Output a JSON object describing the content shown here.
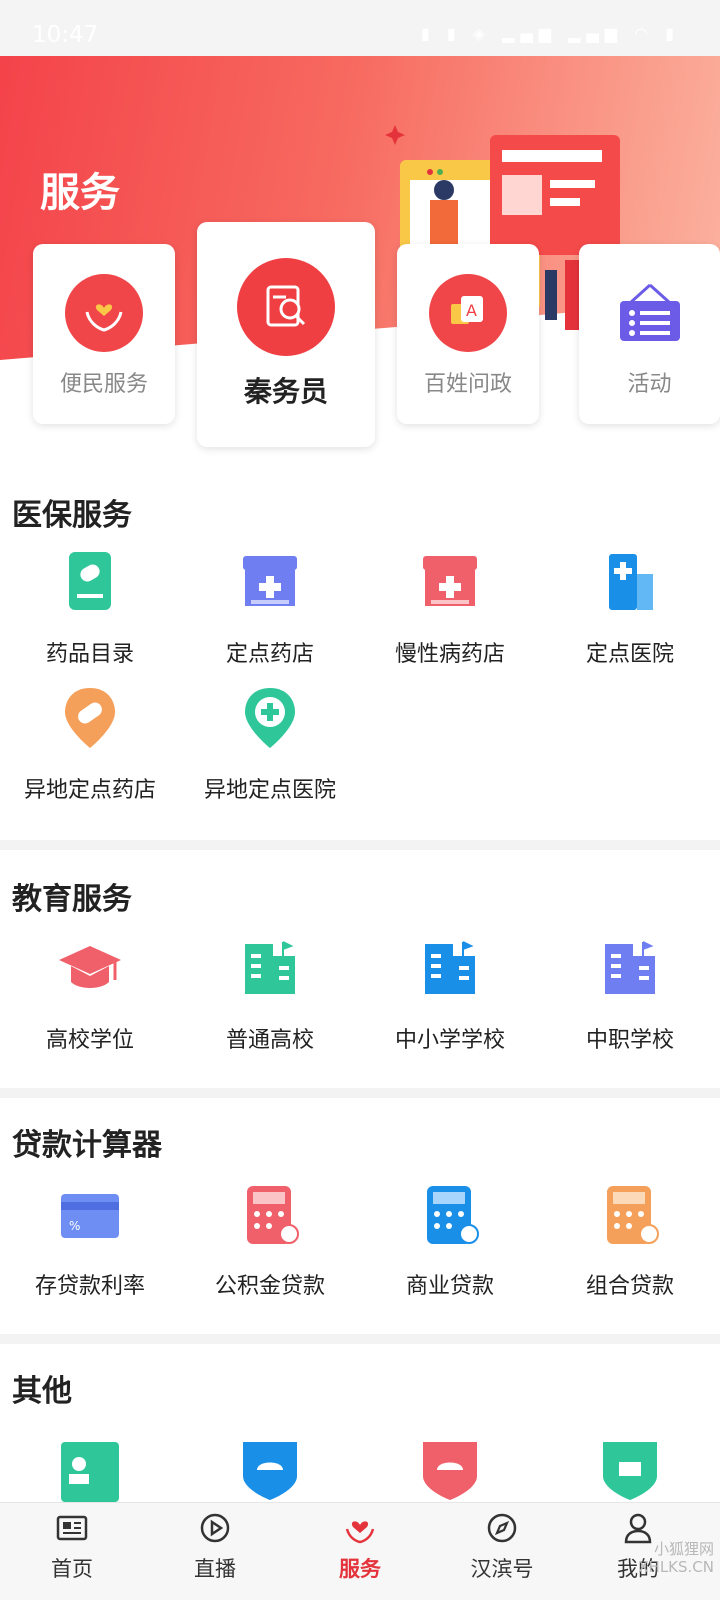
{
  "status": {
    "time": "10:47"
  },
  "header": {
    "title": "服务"
  },
  "top_cards": [
    {
      "label": "便民服务",
      "icon": "hands-heart-icon"
    },
    {
      "label": "秦务员",
      "icon": "search-doc-icon"
    },
    {
      "label": "百姓问政",
      "icon": "question-bubble-icon"
    },
    {
      "label": "活动",
      "icon": "event-board-icon"
    }
  ],
  "sections": {
    "medical": {
      "title": "医保服务",
      "items": [
        {
          "label": "药品目录",
          "icon": "medicine-catalog-icon"
        },
        {
          "label": "定点药店",
          "icon": "pharmacy-icon"
        },
        {
          "label": "慢性病药店",
          "icon": "chronic-pharmacy-icon"
        },
        {
          "label": "定点医院",
          "icon": "hospital-icon"
        },
        {
          "label": "异地定点药店",
          "icon": "remote-pharmacy-icon"
        },
        {
          "label": "异地定点医院",
          "icon": "remote-hospital-icon"
        }
      ]
    },
    "education": {
      "title": "教育服务",
      "items": [
        {
          "label": "高校学位",
          "icon": "graduation-cap-icon"
        },
        {
          "label": "普通高校",
          "icon": "university-icon"
        },
        {
          "label": "中小学学校",
          "icon": "school-icon"
        },
        {
          "label": "中职学校",
          "icon": "vocational-school-icon"
        }
      ]
    },
    "loan": {
      "title": "贷款计算器",
      "items": [
        {
          "label": "存贷款利率",
          "icon": "interest-card-icon"
        },
        {
          "label": "公积金贷款",
          "icon": "fund-calculator-icon"
        },
        {
          "label": "商业贷款",
          "icon": "commercial-calculator-icon"
        },
        {
          "label": "组合贷款",
          "icon": "combined-calculator-icon"
        }
      ]
    },
    "other": {
      "title": "其他"
    }
  },
  "tabbar": [
    {
      "label": "首页",
      "icon": "newspaper-icon"
    },
    {
      "label": "直播",
      "icon": "play-circle-icon"
    },
    {
      "label": "服务",
      "icon": "heart-hands-icon"
    },
    {
      "label": "汉滨号",
      "icon": "compass-icon"
    },
    {
      "label": "我的",
      "icon": "person-icon"
    }
  ],
  "watermark": {
    "line1": "小狐狸网",
    "line2": "XHLKS.CN"
  },
  "colors": {
    "accent": "#e5333b",
    "hero_start": "#f4434a",
    "hero_end": "#fcb7a3"
  }
}
